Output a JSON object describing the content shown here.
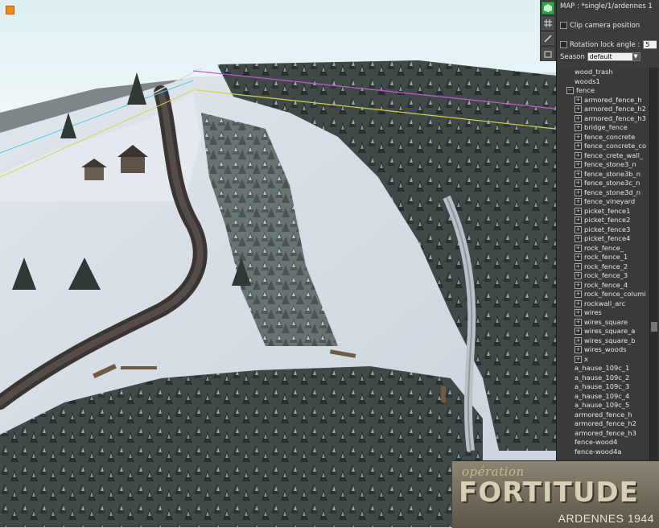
{
  "map_label": "MAP : ",
  "map_value": "*single/1/ardennes 1",
  "options": {
    "clip_camera": "Clip camera position",
    "rotation_lock": "Rotation lock angle :",
    "rotation_value": "5",
    "season_label": "Season",
    "season_value": "default"
  },
  "tree": {
    "items": [
      {
        "label": "wood_trash",
        "type": "leaf"
      },
      {
        "label": "woods1",
        "type": "leaf"
      },
      {
        "label": "fence",
        "type": "folder-open"
      },
      {
        "label": "armored_fence_h",
        "type": "sub"
      },
      {
        "label": "armored_fence_h2",
        "type": "sub"
      },
      {
        "label": "armored_fence_h3",
        "type": "sub"
      },
      {
        "label": "bridge_fence",
        "type": "sub"
      },
      {
        "label": "fence_concrete",
        "type": "sub"
      },
      {
        "label": "fence_concrete_co",
        "type": "sub"
      },
      {
        "label": "fence_crete_wall_",
        "type": "sub"
      },
      {
        "label": "fence_stone3_n",
        "type": "sub"
      },
      {
        "label": "fence_stone3b_n",
        "type": "sub"
      },
      {
        "label": "fence_stone3c_n",
        "type": "sub"
      },
      {
        "label": "fence_stone3d_n",
        "type": "sub"
      },
      {
        "label": "fence_vineyard",
        "type": "sub"
      },
      {
        "label": "picket_fence1",
        "type": "sub"
      },
      {
        "label": "picket_fence2",
        "type": "sub"
      },
      {
        "label": "picket_fence3",
        "type": "sub"
      },
      {
        "label": "picket_fence4",
        "type": "sub"
      },
      {
        "label": "rock_fence_",
        "type": "sub"
      },
      {
        "label": "rock_fence_1",
        "type": "sub"
      },
      {
        "label": "rock_fence_2",
        "type": "sub"
      },
      {
        "label": "rock_fence_3",
        "type": "sub"
      },
      {
        "label": "rock_fence_4",
        "type": "sub"
      },
      {
        "label": "rock_fence_columi",
        "type": "sub"
      },
      {
        "label": "rockwall_arc",
        "type": "sub"
      },
      {
        "label": "wires",
        "type": "sub"
      },
      {
        "label": "wires_square",
        "type": "sub"
      },
      {
        "label": "wires_square_a",
        "type": "sub"
      },
      {
        "label": "wires_square_b",
        "type": "sub"
      },
      {
        "label": "wires_woods",
        "type": "sub"
      },
      {
        "label": "x",
        "type": "sub"
      },
      {
        "label": "a_hause_109c_1",
        "type": "leaf"
      },
      {
        "label": "a_hause_109c_2",
        "type": "leaf"
      },
      {
        "label": "a_hause_109c_3",
        "type": "leaf"
      },
      {
        "label": "a_hause_109c_4",
        "type": "leaf"
      },
      {
        "label": "a_hause_109c_5",
        "type": "leaf"
      },
      {
        "label": "armored_fence_h",
        "type": "leaf"
      },
      {
        "label": "armored_fence_h2",
        "type": "leaf"
      },
      {
        "label": "armored_fence_h3",
        "type": "leaf"
      },
      {
        "label": "fence-wood4",
        "type": "leaf"
      },
      {
        "label": "fence-wood4a",
        "type": "leaf"
      }
    ]
  },
  "logo": {
    "top": "opération",
    "main": "FORTITUDE",
    "sub": "ARDENNES 1944"
  }
}
